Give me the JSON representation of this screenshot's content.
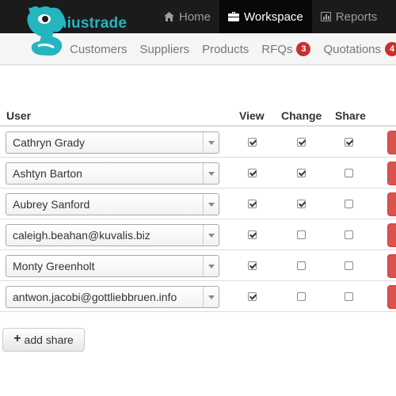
{
  "brand": {
    "name": "eniustrade",
    "logo_color": "#24b5c1"
  },
  "top_nav": {
    "items": [
      {
        "label": "Home",
        "icon": "home-icon",
        "active": false
      },
      {
        "label": "Workspace",
        "icon": "briefcase-icon",
        "active": true
      },
      {
        "label": "Reports",
        "icon": "bar-chart-icon",
        "active": false
      }
    ]
  },
  "sub_nav": {
    "items": [
      {
        "label": "Customers"
      },
      {
        "label": "Suppliers"
      },
      {
        "label": "Products"
      },
      {
        "label": "RFQs",
        "badge": "3"
      },
      {
        "label": "Quotations",
        "badge": "4"
      }
    ]
  },
  "table": {
    "headers": {
      "user": "User",
      "view": "View",
      "change": "Change",
      "share": "Share"
    },
    "rows": [
      {
        "user": "Cathryn Grady",
        "view": true,
        "change": true,
        "share": true
      },
      {
        "user": "Ashtyn Barton",
        "view": true,
        "change": true,
        "share": false
      },
      {
        "user": "Aubrey Sanford",
        "view": true,
        "change": true,
        "share": false
      },
      {
        "user": "caleigh.beahan@kuvalis.biz",
        "view": true,
        "change": false,
        "share": false
      },
      {
        "user": "Monty Greenholt",
        "view": true,
        "change": false,
        "share": false
      },
      {
        "user": "antwon.jacobi@gottliebbruen.info",
        "view": true,
        "change": false,
        "share": false
      }
    ]
  },
  "actions": {
    "add_share_label": "add share",
    "add_icon": "plus-icon"
  },
  "colors": {
    "navbar_bg": "#1b1b1b",
    "navbar_active_bg": "#080808",
    "badge_bg": "#c9302c",
    "danger": "#d9534f"
  }
}
